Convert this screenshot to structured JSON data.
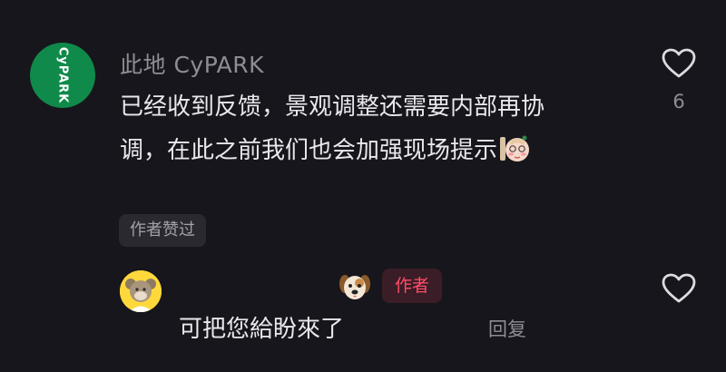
{
  "comment": {
    "author_name": "此地 CyPARK",
    "avatar_logo_text": "CyPARK",
    "text_line1": "已经收到反馈，景观调整还需要内部再协",
    "text_line2": "调，在此之前我们也会加强现场提示",
    "inline_emoji": "shy-face-emoji",
    "like_count": "6",
    "liked_by_author_badge": "作者赞过"
  },
  "reply": {
    "avatar_icon": "sheep-avatar",
    "name_emoji": "dog-face-emoji",
    "author_tag": "作者",
    "text": "可把您給盼來了",
    "reply_label": "回复"
  },
  "colors": {
    "background": "#17161c",
    "primary_text": "#e9e9ec",
    "secondary_text": "#8e8d93",
    "brand_green": "#0f8a4a",
    "author_tag_red": "#ff4d6a"
  }
}
